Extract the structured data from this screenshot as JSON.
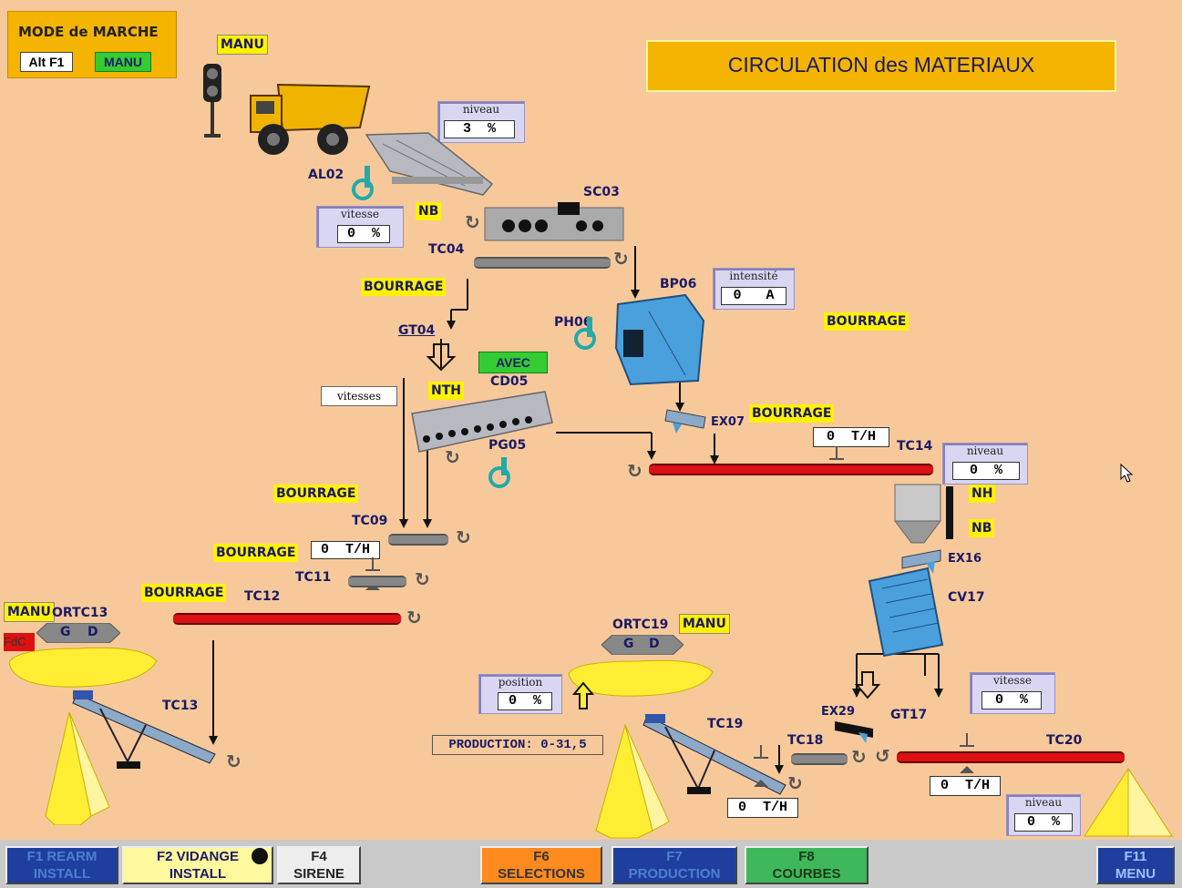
{
  "mode": {
    "title": "MODE de MARCHE",
    "key": "Alt F1",
    "state": "MANU"
  },
  "title": "CIRCULATION des MATERIAUX",
  "manu": "MANU",
  "avec": "AVEC",
  "fdc": "FdC",
  "bourrage": "BOURRAGE",
  "production": "PRODUCTION:  0-31,5",
  "labels": {
    "al02": "AL02",
    "sc03": "SC03",
    "tc04": "TC04",
    "bp06": "BP06",
    "ph06": "PH06",
    "gt04": "GT04",
    "nth": "NTH",
    "cd05": "CD05",
    "pg05": "PG05",
    "ex07": "EX07",
    "tc14": "TC14",
    "tc09": "TC09",
    "tc11": "TC11",
    "tc12": "TC12",
    "ortc13": "ORTC13",
    "tc13": "TC13",
    "ex16": "EX16",
    "cv17": "CV17",
    "ortc19": "ORTC19",
    "ex29": "EX29",
    "gt17": "GT17",
    "tc19": "TC19",
    "tc18": "TC18",
    "tc20": "TC20",
    "nb": "NB",
    "nh": "NH",
    "g": "G",
    "d": "D"
  },
  "panels": {
    "niveau1": {
      "title": "niveau",
      "value": "3",
      "unit": "%"
    },
    "vitesse1": {
      "title": "vitesse",
      "value": "0",
      "unit": "%"
    },
    "intensite": {
      "title": "intensité",
      "value": "0",
      "unit": "A"
    },
    "niveau2": {
      "title": "niveau",
      "value": "0",
      "unit": "%"
    },
    "position": {
      "title": "position",
      "value": "0",
      "unit": "%"
    },
    "vitesse2": {
      "title": "vitesse",
      "value": "0",
      "unit": "%"
    },
    "niveau3": {
      "title": "niveau",
      "value": "0",
      "unit": "%"
    }
  },
  "vitesses": "vitesses",
  "flows": {
    "ex07": {
      "value": "0",
      "unit": "T/H"
    },
    "tc11": {
      "value": "0",
      "unit": "T/H"
    },
    "tc19": {
      "value": "0",
      "unit": "T/H"
    },
    "tc20": {
      "value": "0",
      "unit": "T/H"
    }
  },
  "fkeys": [
    {
      "top": "F1  REARM",
      "bottom": "INSTALL"
    },
    {
      "top": "F2  VIDANGE",
      "bottom": "INSTALL"
    },
    {
      "top": "F4",
      "bottom": "SIRENE"
    },
    {
      "top": "F6",
      "bottom": "SELECTIONS"
    },
    {
      "top": "F7",
      "bottom": "PRODUCTION"
    },
    {
      "top": "F8",
      "bottom": "COURBES"
    },
    {
      "top": "F11",
      "bottom": "MENU"
    }
  ],
  "colors": {
    "background": "#f7c99a",
    "yellow": "#fff200",
    "red_conveyor": "#d11111",
    "label": "#1a1a66"
  }
}
